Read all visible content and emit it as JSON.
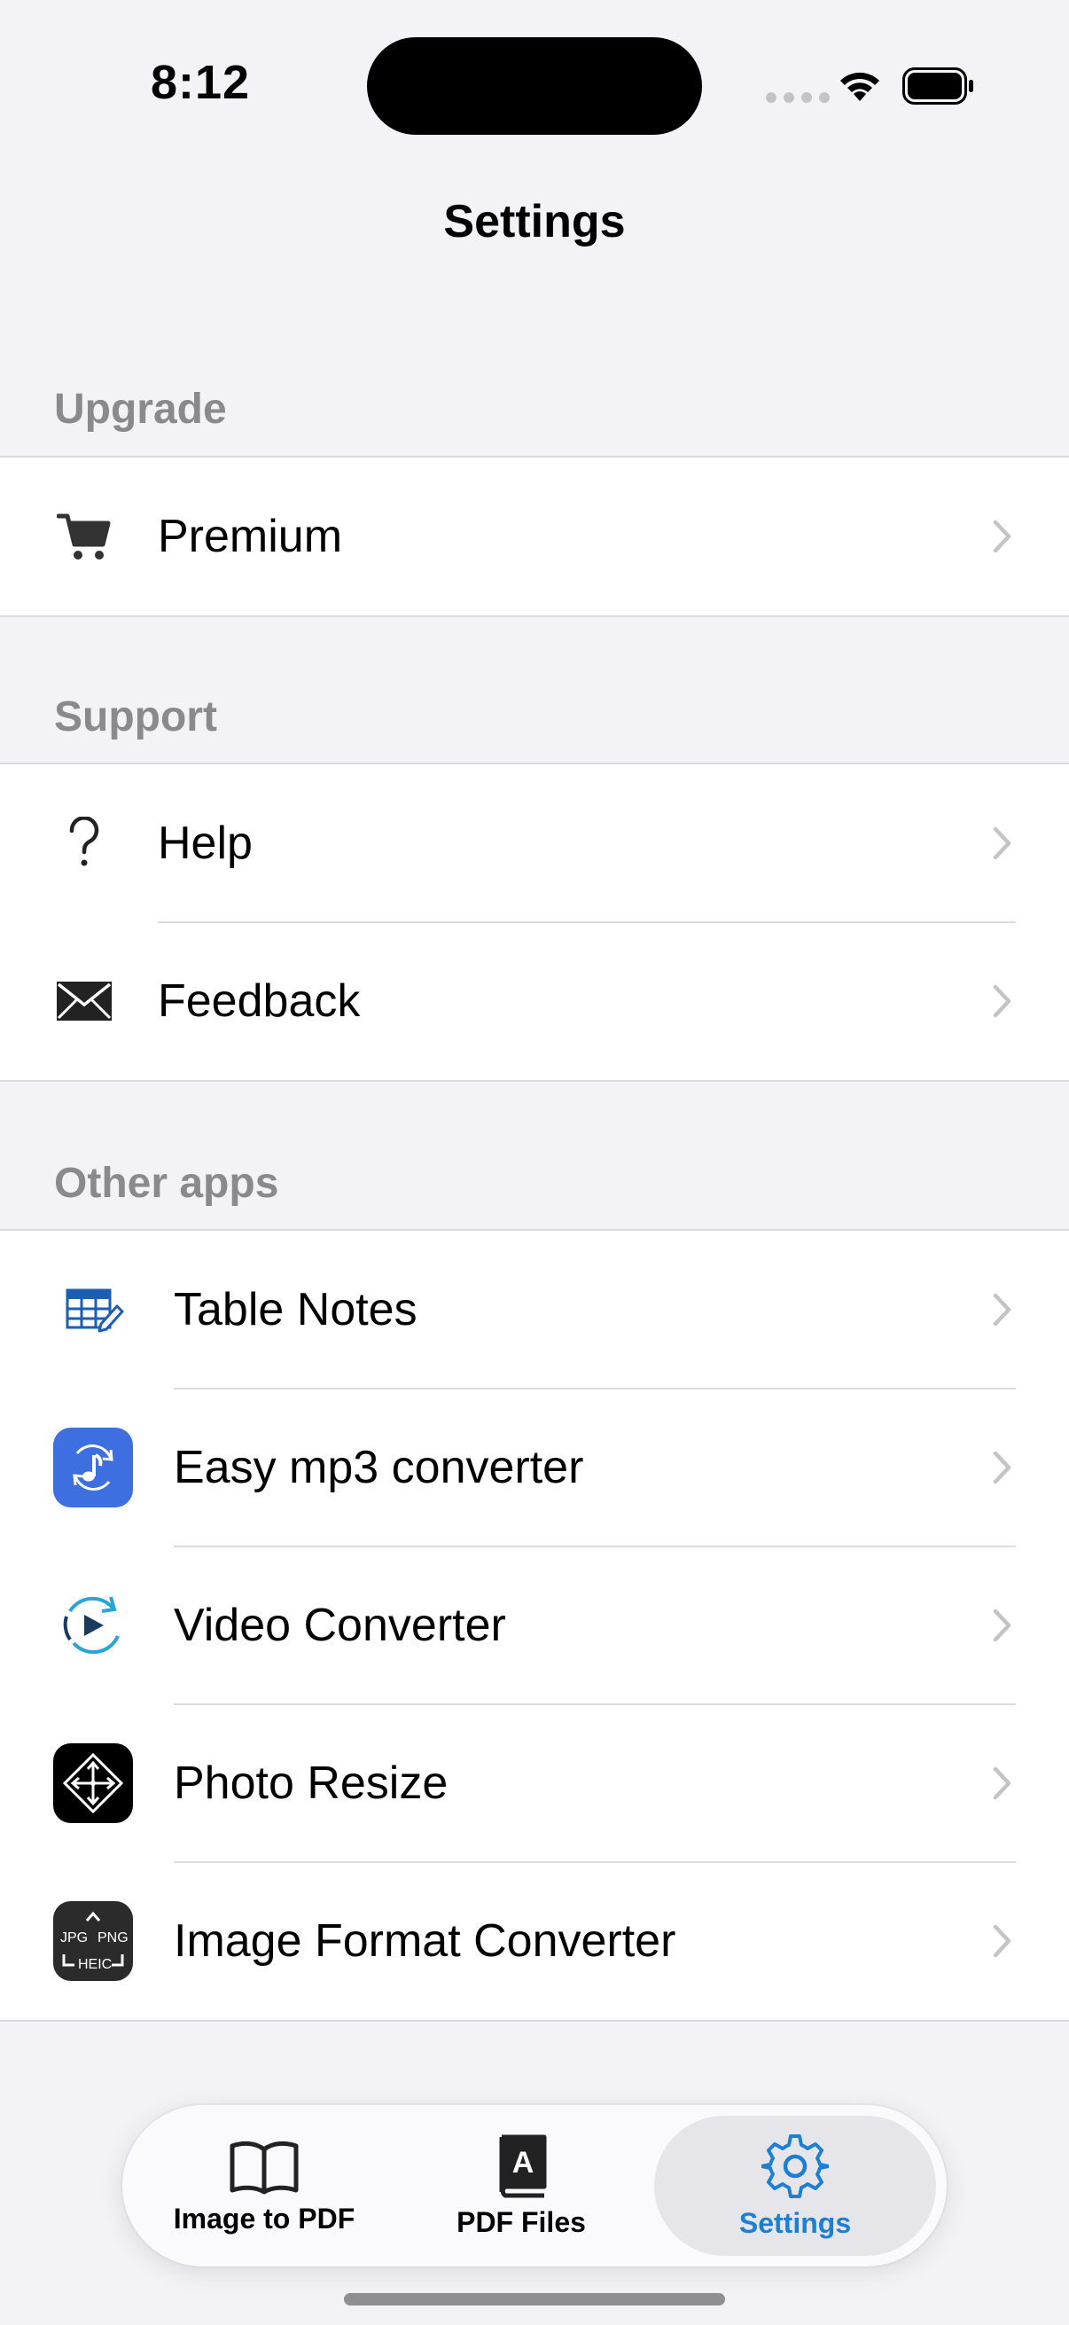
{
  "status_bar": {
    "time": "8:12"
  },
  "nav": {
    "title": "Settings"
  },
  "sections": {
    "upgrade": {
      "header": "Upgrade",
      "items": [
        {
          "label": "Premium",
          "icon": "cart-icon"
        }
      ]
    },
    "support": {
      "header": "Support",
      "items": [
        {
          "label": "Help",
          "icon": "question-icon"
        },
        {
          "label": "Feedback",
          "icon": "envelope-icon"
        }
      ]
    },
    "other_apps": {
      "header": "Other apps",
      "items": [
        {
          "label": "Table Notes",
          "icon": "table-notes-icon"
        },
        {
          "label": "Easy mp3 converter",
          "icon": "mp3-converter-icon"
        },
        {
          "label": "Video Converter",
          "icon": "video-converter-icon"
        },
        {
          "label": "Photo Resize",
          "icon": "photo-resize-icon"
        },
        {
          "label": "Image Format Converter",
          "icon": "image-format-converter-icon",
          "tile_text": [
            "JPG",
            "PNG",
            "HEIC"
          ]
        }
      ]
    }
  },
  "tab_bar": {
    "tabs": [
      {
        "label": "Image to PDF",
        "icon": "book-icon",
        "selected": false
      },
      {
        "label": "PDF Files",
        "icon": "pdf-book-icon",
        "selected": false,
        "icon_letter": "A"
      },
      {
        "label": "Settings",
        "icon": "gear-icon",
        "selected": true
      }
    ]
  },
  "colors": {
    "background": "#f2f2f7",
    "accent": "#1c7fd6",
    "section_header": "#8a8a8e",
    "mp3_tile": "#3d6fe0",
    "chevron": "#c4c4c7"
  }
}
